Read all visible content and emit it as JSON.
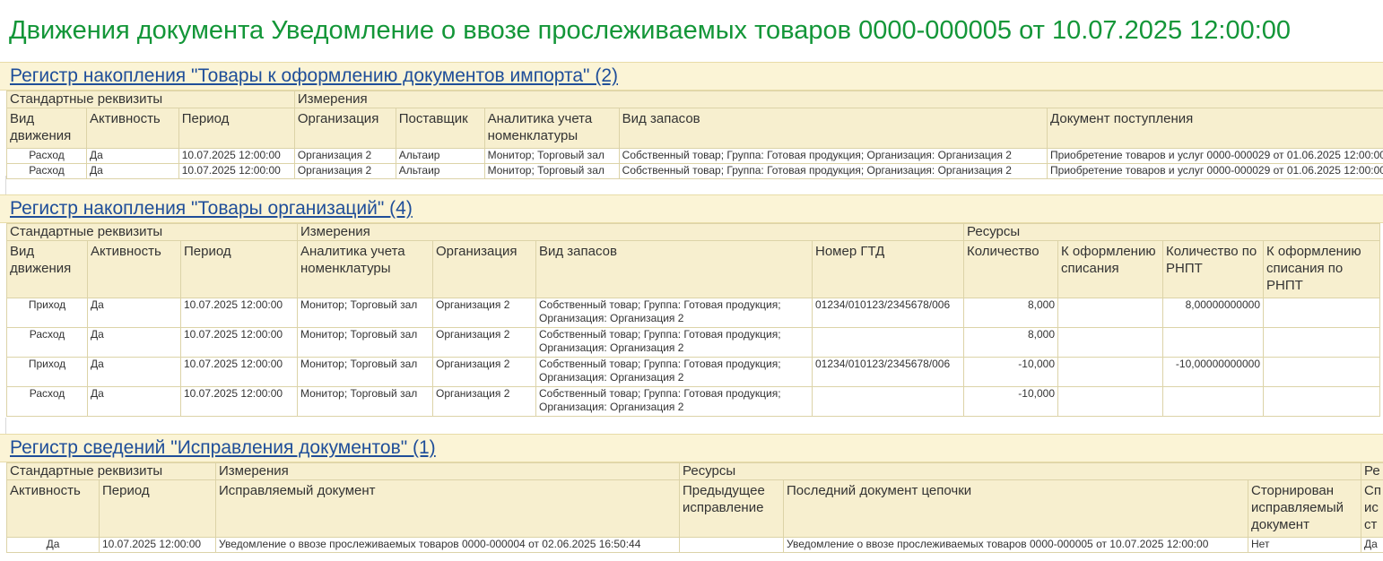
{
  "page_title": "Движения документа Уведомление о ввозе прослеживаемых товаров 0000-000005 от 10.07.2025 12:00:00",
  "colors": {
    "title": "#139638",
    "link": "#1f4e99",
    "expense": "#d21a1a",
    "income": "#1f8a2a",
    "header_bg": "#f7efcf"
  },
  "register1": {
    "title": "Регистр накопления \"Товары к оформлению документов импорта\" (2)",
    "groups": [
      "Стандартные реквизиты",
      "Измерения"
    ],
    "columns": [
      "Вид движения",
      "Активность",
      "Период",
      "Организация",
      "Поставщик",
      "Аналитика учета номенклатуры",
      "Вид запасов",
      "Документ поступления"
    ],
    "rows": [
      {
        "movement": "Расход",
        "movement_type": "expense",
        "activity": "Да",
        "period": "10.07.2025 12:00:00",
        "organization": "Организация 2",
        "supplier": "Альтаир",
        "analytics": "Монитор; Торговый зал",
        "stock_type": "Собственный товар; Группа: Готовая продукция; Организация: Организация 2",
        "receipt_doc": "Приобретение товаров и услуг 0000-000029 от 01.06.2025 12:00:00"
      },
      {
        "movement": "Расход",
        "movement_type": "expense",
        "activity": "Да",
        "period": "10.07.2025 12:00:00",
        "organization": "Организация 2",
        "supplier": "Альтаир",
        "analytics": "Монитор; Торговый зал",
        "stock_type": "Собственный товар; Группа: Готовая продукция; Организация: Организация 2",
        "receipt_doc": "Приобретение товаров и услуг 0000-000029 от 01.06.2025 12:00:00"
      }
    ]
  },
  "register2": {
    "title": "Регистр накопления \"Товары организаций\" (4)",
    "groups": [
      "Стандартные реквизиты",
      "Измерения",
      "Ресурсы"
    ],
    "columns": [
      "Вид движения",
      "Активность",
      "Период",
      "Аналитика учета номенклатуры",
      "Организация",
      "Вид запасов",
      "Номер ГТД",
      "Количество",
      "К оформлению списания",
      "Количество по РНПТ",
      "К оформлению списания по РНПТ"
    ],
    "rows": [
      {
        "movement": "Приход",
        "movement_type": "income",
        "activity": "Да",
        "period": "10.07.2025 12:00:00",
        "analytics": "Монитор; Торговый зал",
        "organization": "Организация 2",
        "stock_type": "Собственный товар; Группа: Готовая продукция; Организация: Организация 2",
        "gtd": "01234/010123/2345678/006",
        "qty": "8,000",
        "qty_negative": false,
        "to_write_off": "",
        "qty_rnpt": "8,00000000000",
        "to_write_off_rnpt": ""
      },
      {
        "movement": "Расход",
        "movement_type": "expense",
        "activity": "Да",
        "period": "10.07.2025 12:00:00",
        "analytics": "Монитор; Торговый зал",
        "organization": "Организация 2",
        "stock_type": "Собственный товар; Группа: Готовая продукция; Организация: Организация 2",
        "gtd": "",
        "qty": "8,000",
        "qty_negative": false,
        "to_write_off": "",
        "qty_rnpt": "",
        "to_write_off_rnpt": ""
      },
      {
        "movement": "Приход",
        "movement_type": "income",
        "activity": "Да",
        "period": "10.07.2025 12:00:00",
        "analytics": "Монитор; Торговый зал",
        "organization": "Организация 2",
        "stock_type": "Собственный товар; Группа: Готовая продукция; Организация: Организация 2",
        "gtd": "01234/010123/2345678/006",
        "qty": "-10,000",
        "qty_negative": true,
        "to_write_off": "",
        "qty_rnpt": "-10,00000000000",
        "to_write_off_rnpt": ""
      },
      {
        "movement": "Расход",
        "movement_type": "expense",
        "activity": "Да",
        "period": "10.07.2025 12:00:00",
        "analytics": "Монитор; Торговый зал",
        "organization": "Организация 2",
        "stock_type": "Собственный товар; Группа: Готовая продукция; Организация: Организация 2",
        "gtd": "",
        "qty": "-10,000",
        "qty_negative": true,
        "to_write_off": "",
        "qty_rnpt": "",
        "to_write_off_rnpt": ""
      }
    ]
  },
  "register3": {
    "title": "Регистр сведений \"Исправления документов\" (1)",
    "groups": [
      "Стандартные реквизиты",
      "Измерения",
      "Ресурсы",
      "Ре"
    ],
    "columns": [
      "Активность",
      "Период",
      "Исправляемый документ",
      "Предыдущее исправление",
      "Последний документ цепочки",
      "Сторнирован исправляемый документ",
      "Сп ис ст"
    ],
    "rows": [
      {
        "activity": "Да",
        "period": "10.07.2025 12:00:00",
        "corrected_doc": "Уведомление о ввозе прослеживаемых товаров 0000-000004 от 02.06.2025 16:50:44",
        "prev_correction": "",
        "last_doc": "Уведомление о ввозе прослеживаемых товаров 0000-000005 от 10.07.2025 12:00:00",
        "reversed": "Нет",
        "extra": "Да"
      }
    ]
  }
}
